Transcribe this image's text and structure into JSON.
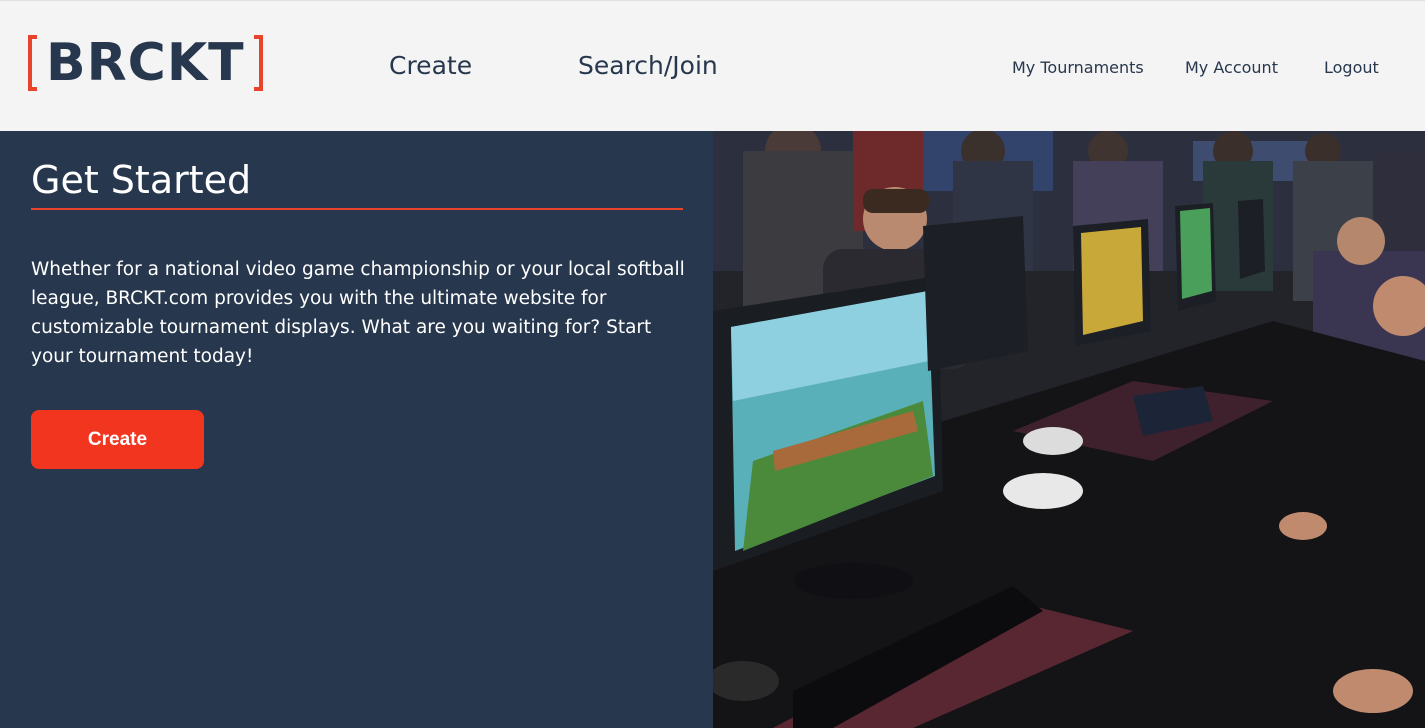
{
  "header": {
    "logo_text": "BRCKT",
    "nav_main": {
      "create": "Create",
      "search_join": "Search/Join"
    },
    "nav_right": {
      "my_tournaments": "My Tournaments",
      "my_account": "My Account",
      "logout": "Logout"
    }
  },
  "hero": {
    "title": "Get Started",
    "description": "Whether for a national video game championship or your local softball league, BRCKT.com provides you with the ultimate website for customizable tournament displays. What are you waiting for? Start your tournament today!",
    "create_button": "Create"
  },
  "colors": {
    "accent": "#e8432b",
    "navy": "#27374d",
    "button": "#f2351f",
    "header_bg": "#f4f4f4"
  }
}
